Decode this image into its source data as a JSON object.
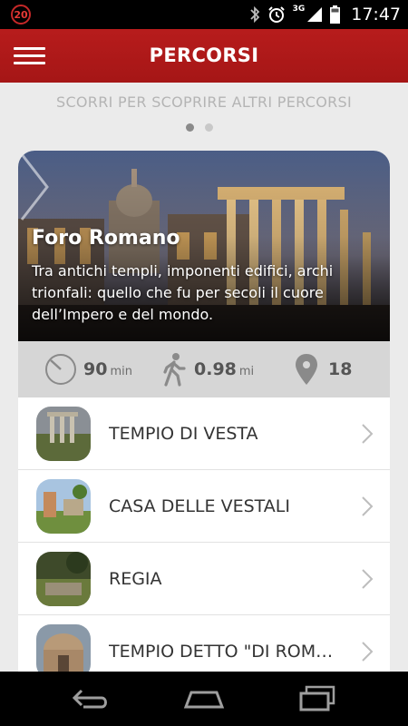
{
  "status_bar": {
    "notification_count": "20",
    "network": "3G",
    "time": "17:47"
  },
  "app_bar": {
    "title": "PERCORSI"
  },
  "pager": {
    "hint": "SCORRI PER SCOPRIRE ALTRI PERCORSI",
    "pages": 2,
    "active_page": 1
  },
  "route_card": {
    "title": "Foro Romano",
    "description": "Tra antichi templi, imponenti edifici, archi trionfali: quello che fu per secoli il cuore dell’Impero e del mondo.",
    "stats": {
      "duration_value": "90",
      "duration_unit": "min",
      "distance_value": "0.98",
      "distance_unit": "mi",
      "stops_value": "18"
    },
    "stops": [
      {
        "label": "TEMPIO DI VESTA"
      },
      {
        "label": "CASA DELLE VESTALI"
      },
      {
        "label": "REGIA"
      },
      {
        "label": "TEMPIO DETTO \"DI ROMOLO\""
      }
    ]
  },
  "colors": {
    "app_bar": "#b71c1c",
    "background": "#ebebeb",
    "stats_bar": "#d6d6d6",
    "hint_text": "#b4b4b4"
  },
  "icons": {
    "menu": "hamburger-icon",
    "duration": "stopwatch-icon",
    "distance": "walking-icon",
    "stops": "location-pin-icon",
    "row_arrow": "chevron-right-icon",
    "nav": [
      "back-icon",
      "home-icon",
      "recents-icon"
    ]
  }
}
